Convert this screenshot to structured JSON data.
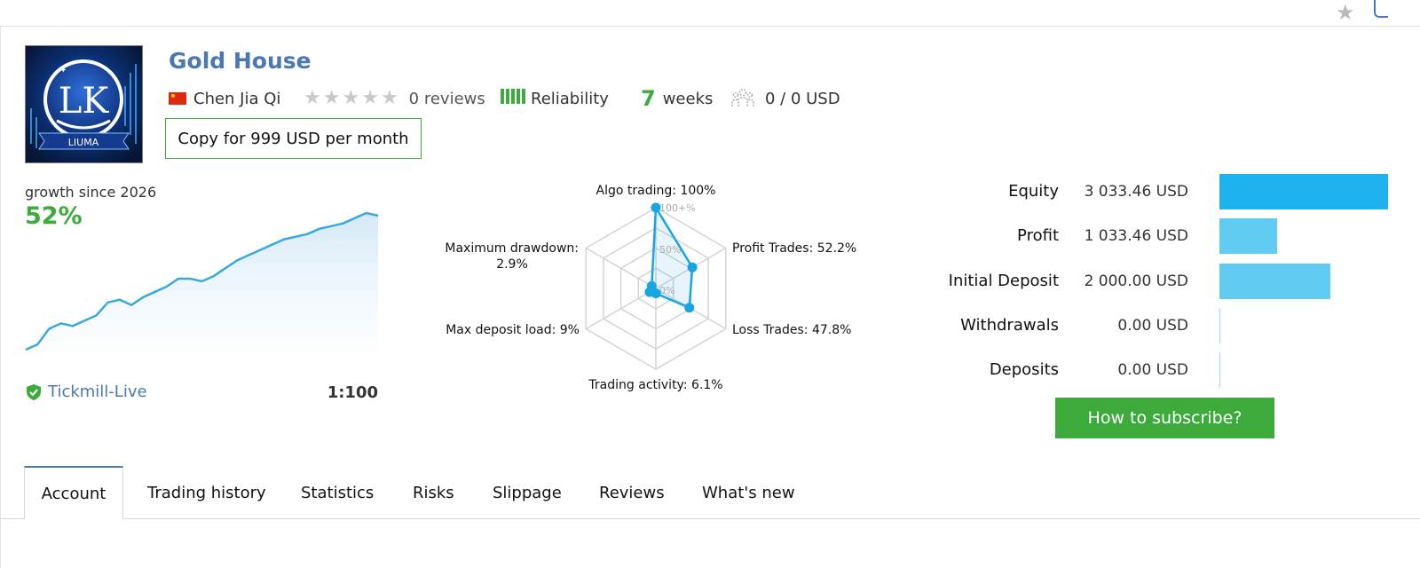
{
  "signal": {
    "title": "Gold House",
    "author": "Chen Jia Qi",
    "reviews": "0 reviews",
    "reliability_label": "Reliability",
    "weeks_value": "7",
    "weeks_label": "weeks",
    "subscribers": "0 / 0 USD",
    "copy_button": "Copy for 999 USD per month",
    "logo_text": "LK",
    "logo_caption": "LIUMA"
  },
  "growth": {
    "label": "growth since 2026",
    "value": "52%",
    "broker": "Tickmill-Live",
    "leverage": "1:100"
  },
  "radar": {
    "labels": {
      "top": "Algo trading: 100%",
      "upper_right": "Profit Trades: 52.2%",
      "lower_right": "Loss Trades: 47.8%",
      "bottom": "Trading activity: 6.1%",
      "lower_left": "Max deposit load: 9%",
      "upper_left_1": "Maximum drawdown:",
      "upper_left_2": "2.9%"
    },
    "ticks": {
      "t100": "100+%",
      "t50": "50%",
      "t0": "0%"
    }
  },
  "stats": [
    {
      "label": "Equity",
      "value": "3 033.46 USD",
      "fraction": 1.0,
      "color": "#1fb2ee"
    },
    {
      "label": "Profit",
      "value": "1 033.46 USD",
      "fraction": 0.3407,
      "color": "#5fcbf1"
    },
    {
      "label": "Initial Deposit",
      "value": "2 000.00 USD",
      "fraction": 0.6593,
      "color": "#5fcbf1"
    },
    {
      "label": "Withdrawals",
      "value": "0.00 USD",
      "fraction": 0.0,
      "color": "#5fcbf1"
    },
    {
      "label": "Deposits",
      "value": "0.00 USD",
      "fraction": 0.0,
      "color": "#5fcbf1"
    }
  ],
  "subscribe_button": "How to subscribe?",
  "tabs": [
    {
      "label": "Account"
    },
    {
      "label": "Trading history"
    },
    {
      "label": "Statistics"
    },
    {
      "label": "Risks"
    },
    {
      "label": "Slippage"
    },
    {
      "label": "Reviews"
    },
    {
      "label": "What's new"
    }
  ],
  "chart_data": [
    {
      "type": "line",
      "title": "growth since 2026",
      "values": [
        0,
        2,
        8,
        10,
        9,
        11,
        13,
        18,
        19,
        17,
        20,
        22,
        24,
        27,
        27,
        26,
        28,
        31,
        34,
        36,
        38,
        40,
        42,
        43,
        44,
        46,
        47,
        48,
        50,
        52,
        51
      ],
      "xlabel": "",
      "ylabel": ""
    },
    {
      "type": "radar",
      "axes": [
        "Algo trading",
        "Profit Trades",
        "Loss Trades",
        "Trading activity",
        "Max deposit load",
        "Maximum drawdown"
      ],
      "values": [
        100,
        52.2,
        47.8,
        6.1,
        9,
        2.9
      ],
      "ticks": [
        "0%",
        "50%",
        "100+%"
      ]
    },
    {
      "type": "bar",
      "categories": [
        "Equity",
        "Profit",
        "Initial Deposit",
        "Withdrawals",
        "Deposits"
      ],
      "values": [
        3033.46,
        1033.46,
        2000.0,
        0.0,
        0.0
      ]
    }
  ],
  "colors": {
    "accent": "#4a78b5",
    "green": "#3cab3c",
    "chart_blue": "#39a8e0"
  }
}
